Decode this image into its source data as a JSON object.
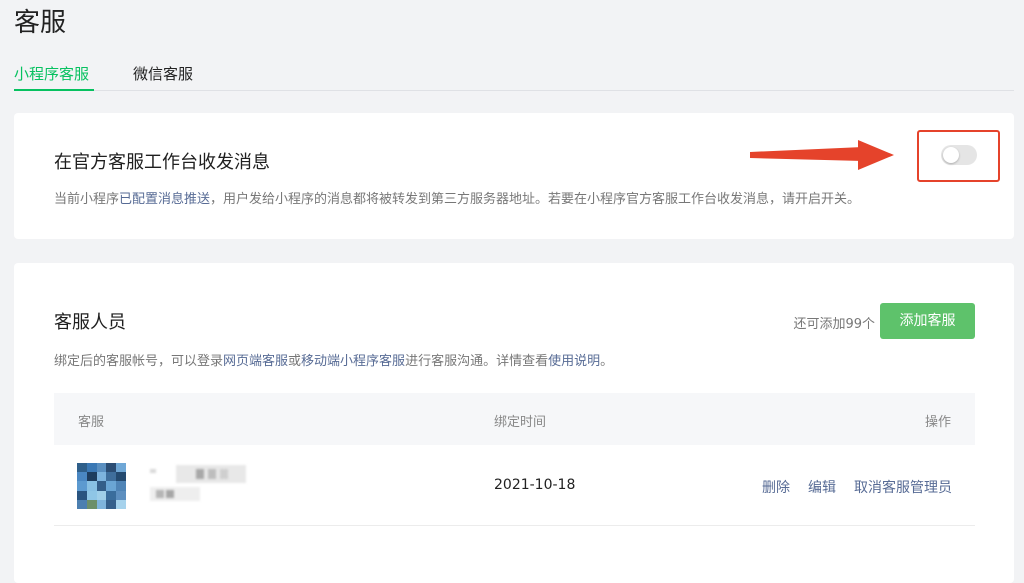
{
  "page": {
    "title": "客服"
  },
  "tabs": [
    {
      "label": "小程序客服",
      "active": true
    },
    {
      "label": "微信客服",
      "active": false
    }
  ],
  "official_workbench": {
    "title": "在官方客服工作台收发消息",
    "desc_prefix": "当前小程序",
    "desc_link": "已配置消息推送",
    "desc_suffix": "，用户发给小程序的消息都将被转发到第三方服务器地址。若要在小程序官方客服工作台收发消息，请开启开关。",
    "switch_on": false
  },
  "staff": {
    "title": "客服人员",
    "remaining": "还可添加99个",
    "add_button": "添加客服",
    "desc_1": "绑定后的客服帐号，可以登录",
    "link_web": "网页端客服",
    "desc_2": "或",
    "link_mobile": "移动端小程序客服",
    "desc_3": "进行客服沟通。详情查看",
    "link_help": "使用说明",
    "desc_4": "。",
    "columns": {
      "staff": "客服",
      "bind_time": "绑定时间",
      "actions": "操作"
    },
    "rows": [
      {
        "bind_time": "2021-10-18",
        "actions": {
          "delete": "删除",
          "edit": "编辑",
          "revoke_admin": "取消客服管理员"
        }
      }
    ]
  },
  "colors": {
    "accent": "#07c160",
    "button_green": "#5ec26b",
    "link": "#576b95",
    "annotation_red": "#e5432b"
  }
}
